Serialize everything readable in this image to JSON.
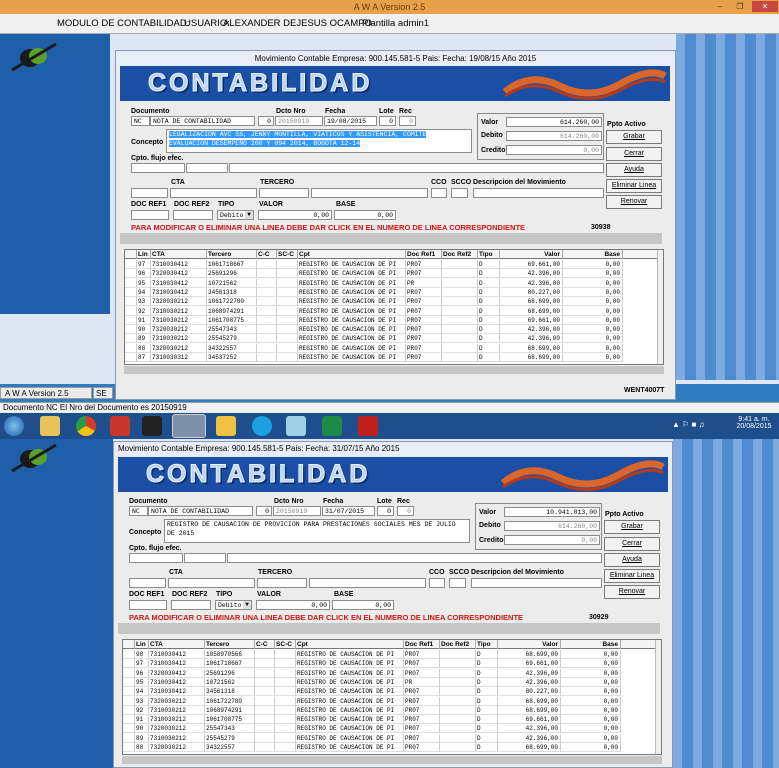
{
  "window": {
    "title": "A W A Version 2.5"
  },
  "app_header": {
    "modulo": "MODULO DE CONTABILIDAD:",
    "usuario_label": "USUARIO:",
    "usuario": "ALEXANDER DEJESUS OCAMPO",
    "plantilla": "Plantilla admin1"
  },
  "form1": {
    "title": "Movimiento  Contable  Empresa: 900.145.581-5  Pais:   Fecha: 19/08/15   Año  2015",
    "banner": "CONTABILIDAD",
    "labels": {
      "documento": "Documento",
      "dcto_nro": "Dcto Nro",
      "fecha": "Fecha",
      "lote": "Lote",
      "rec": "Rec",
      "concepto": "Concepto",
      "cpto_flujo": "Cpto. flujo efec.",
      "cta": "CTA",
      "tercero": "TERCERO",
      "cco": "CCO",
      "scco": "SCCO",
      "descripcion": "Descripcion del Movimiento",
      "doc_ref1": "DOC REF1",
      "doc_ref2": "DOC REF2",
      "tipo": "TIPO",
      "valor": "VALOR",
      "base": "BASE",
      "valor_r": "Valor",
      "debito": "Debito",
      "credito": "Credito",
      "ppto": "Ppto Activo"
    },
    "documento_code": "NC",
    "documento_name": "NOTA DE CONTABILIDAD",
    "dcto_nro_prefix": "0",
    "dcto_nro": "20150919",
    "fecha": "19/08/2015",
    "lote": "0",
    "rec": "0",
    "concepto": "LEGALIZACION AVC SS, JENNY MONTILLA, VIATICOS Y ASISTENCIA, COMITE EVALUACION DESEMPEÑO 200 Y 094 2014, BOGOTA 12-14",
    "tipo": "Debito",
    "valor_line": "0,00",
    "base_line": "0,00",
    "valor": "614.260,00",
    "debito": "614.260,00",
    "credito": "0,00",
    "buttons": {
      "grabar": "Grabar",
      "cerrar": "Cerrar",
      "ayuda": "Ayuda",
      "eliminar": "Eliminar Linea",
      "renovar": "Renovar"
    },
    "warning": "PARA MODIFICAR O ELIMINAR UNA LINEA DEBE DAR CLICK EN EL NUMERO DE LINEA CORRESPONDIENTE",
    "counter": "30938",
    "columns": [
      "Lin",
      "CTA",
      "Tercero",
      "C-C",
      "SC-C",
      "Cpt",
      "Doc Ref1",
      "Doc Ref2",
      "Tipo",
      "Valor",
      "Base"
    ],
    "rows": [
      [
        "97",
        "7310030412",
        "1061718667",
        "",
        "",
        "REGISTRO DE CAUSACION DE PI",
        "PR07",
        "",
        "D",
        "69.661,00",
        "0,00"
      ],
      [
        "96",
        "7320030412",
        "25691296",
        "",
        "",
        "REGISTRO DE CAUSACION DE PI",
        "PR07",
        "",
        "D",
        "42.396,00",
        "0,00"
      ],
      [
        "95",
        "7310030412",
        "10721562",
        "",
        "",
        "REGISTRO DE CAUSACION DE PI",
        "PR",
        "",
        "D",
        "42.396,00",
        "0,00"
      ],
      [
        "94",
        "7310030412",
        "34561318",
        "",
        "",
        "REGISTRO DE CAUSACION DE PI",
        "PR07",
        "",
        "D",
        "80.227,00",
        "0,00"
      ],
      [
        "93",
        "7320030212",
        "1061722780",
        "",
        "",
        "REGISTRO DE CAUSACION DE PI",
        "PR07",
        "",
        "D",
        "68.699,00",
        "0,00"
      ],
      [
        "92",
        "7310030212",
        "1068974291",
        "",
        "",
        "REGISTRO DE CAUSACION DE PI",
        "PR07",
        "",
        "D",
        "68.699,00",
        "0,00"
      ],
      [
        "91",
        "7310030212",
        "1061708775",
        "",
        "",
        "REGISTRO DE CAUSACION DE PI",
        "PR07",
        "",
        "D",
        "69.661,00",
        "0,00"
      ],
      [
        "90",
        "7320030212",
        "25547343",
        "",
        "",
        "REGISTRO DE CAUSACION DE PI",
        "PR07",
        "",
        "D",
        "42.396,00",
        "0,00"
      ],
      [
        "89",
        "7310030212",
        "25545279",
        "",
        "",
        "REGISTRO DE CAUSACION DE PI",
        "PR07",
        "",
        "D",
        "42.396,00",
        "0,00"
      ],
      [
        "88",
        "7320030212",
        "34322557",
        "",
        "",
        "REGISTRO DE CAUSACION DE PI",
        "PR07",
        "",
        "D",
        "68.699,00",
        "0,00"
      ],
      [
        "87",
        "7310030312",
        "34537252",
        "",
        "",
        "REGISTRO DE CAUSACION DE PI",
        "PR07",
        "",
        "D",
        "68.699,00",
        "0,00"
      ]
    ],
    "footer_code": "WENT4007T"
  },
  "form2": {
    "title": "Movimiento  Contable  Empresa: 900.145.581-5  Pais:   Fecha: 31/07/15   Año  2015",
    "dcto_nro": "20150919",
    "fecha": "31/07/2015",
    "concepto": "REGISTRO DE CAUSACION DE PROVICION PARA PRESTACIONES SOCIALES MES DE JULIO DE 2015",
    "valor": "10.941.813,00",
    "debito": "614.260,00",
    "credito": "0,00",
    "counter": "30929",
    "rows": [
      [
        "98",
        "7310030412",
        "1058970566",
        "",
        "",
        "REGISTRO DE CAUSACION DE PI",
        "PR07",
        "",
        "D",
        "68.699,00",
        "0,00"
      ],
      [
        "97",
        "7310030412",
        "1061718667",
        "",
        "",
        "REGISTRO DE CAUSACION DE PI",
        "PR07",
        "",
        "D",
        "69.661,00",
        "0,00"
      ],
      [
        "96",
        "7320030412",
        "25691296",
        "",
        "",
        "REGISTRO DE CAUSACION DE PI",
        "PR07",
        "",
        "D",
        "42.396,00",
        "0,00"
      ],
      [
        "95",
        "7310030412",
        "10721562",
        "",
        "",
        "REGISTRO DE CAUSACION DE PI",
        "PR",
        "",
        "D",
        "42.396,00",
        "0,00"
      ],
      [
        "94",
        "7310030412",
        "34561318",
        "",
        "",
        "REGISTRO DE CAUSACION DE PI",
        "PR07",
        "",
        "D",
        "80.227,00",
        "0,00"
      ],
      [
        "93",
        "7320030212",
        "1061722780",
        "",
        "",
        "REGISTRO DE CAUSACION DE PI",
        "PR07",
        "",
        "D",
        "68.699,00",
        "0,00"
      ],
      [
        "92",
        "7310030212",
        "1068974291",
        "",
        "",
        "REGISTRO DE CAUSACION DE PI",
        "PR07",
        "",
        "D",
        "68.699,00",
        "0,00"
      ],
      [
        "91",
        "7310030212",
        "1061708775",
        "",
        "",
        "REGISTRO DE CAUSACION DE PI",
        "PR07",
        "",
        "D",
        "69.661,00",
        "0,00"
      ],
      [
        "90",
        "7320030212",
        "25547343",
        "",
        "",
        "REGISTRO DE CAUSACION DE PI",
        "PR07",
        "",
        "D",
        "42.396,00",
        "0,00"
      ],
      [
        "89",
        "7310030212",
        "25545279",
        "",
        "",
        "REGISTRO DE CAUSACION DE PI",
        "PR07",
        "",
        "D",
        "42.396,00",
        "0,00"
      ],
      [
        "88",
        "7320030212",
        "34322557",
        "",
        "",
        "REGISTRO DE CAUSACION DE PI",
        "PR07",
        "",
        "D",
        "68.699,00",
        "0,00"
      ]
    ]
  },
  "mdi_tabs": [
    {
      "label": "A W A Version 2.5"
    },
    {
      "label": "SE"
    }
  ],
  "status_bar": {
    "text": "Documento  NC  El Nro del Documento es   20150919"
  },
  "taskbar": {
    "time": "9:41 a. m.",
    "date": "20/08/2015",
    "icons": [
      "start-orb",
      "file-explorer",
      "chrome",
      "delphi",
      "terminal",
      "awa-app",
      "folder",
      "skype",
      "notes",
      "excel",
      "acrobat"
    ]
  }
}
